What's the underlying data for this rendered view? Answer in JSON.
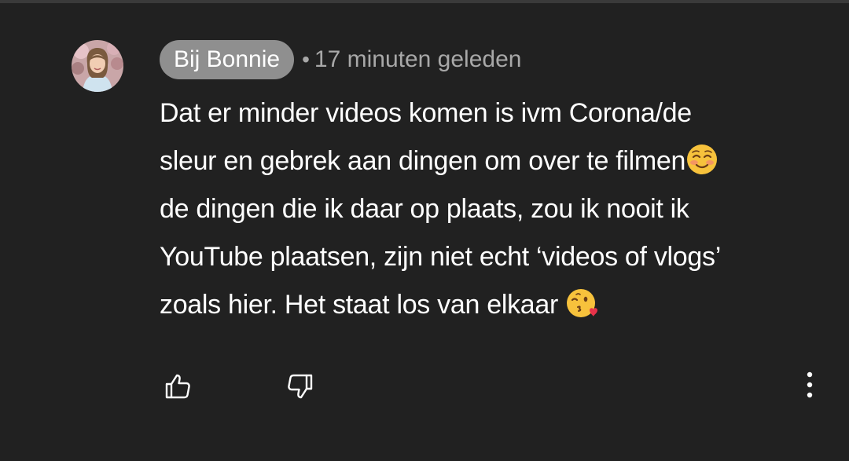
{
  "comment": {
    "author": "Bij Bonnie",
    "separator": "•",
    "timestamp": "17 minuten geleden",
    "lines": [
      "Dat er minder videos komen is ivm Corona/de",
      "sleur en gebrek aan dingen om over te filmen",
      "de dingen die ik daar op plaats, zou ik nooit ik",
      "YouTube plaatsen, zijn niet echt ‘videos of vlogs’",
      "zoals hier. Het staat los van elkaar "
    ],
    "emojis": [
      "smiling-face-with-blush-emoji",
      "face-blowing-kiss-emoji"
    ]
  },
  "actions": {
    "like_icon": "thumbs-up-icon",
    "dislike_icon": "thumbs-down-icon",
    "more_icon": "more-vertical-icon"
  },
  "colors": {
    "background": "#212121",
    "text": "#ffffff",
    "muted": "#a8a8a8",
    "author_chip": "#8f8f8f"
  }
}
